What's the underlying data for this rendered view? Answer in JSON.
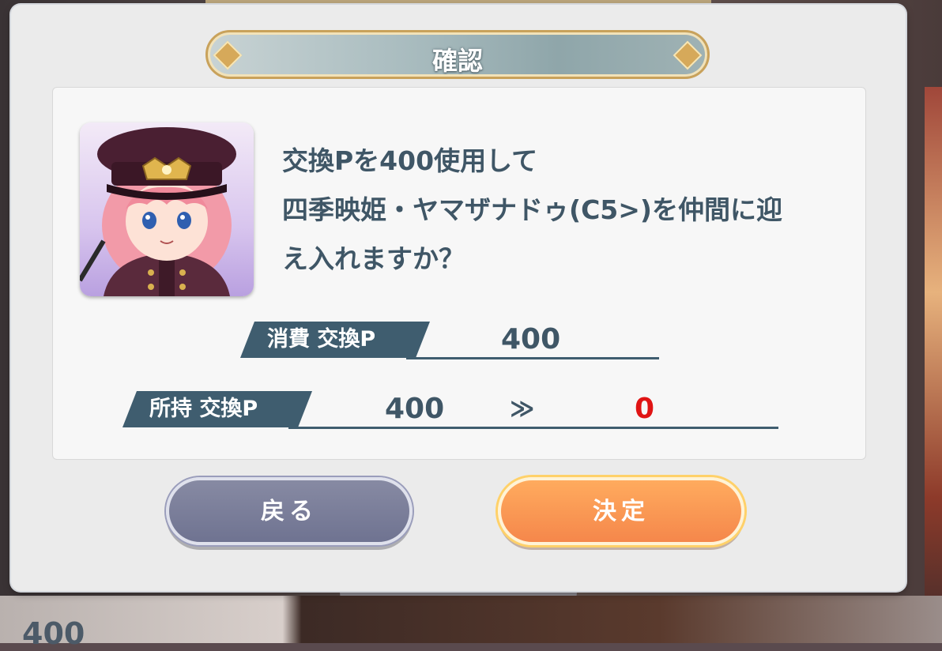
{
  "dialog": {
    "title": "確認",
    "message_lines": [
      "交換Pを400使用して",
      "四季映姫・ヤマザナドゥ(C5>)を仲間に迎",
      "え入れますか？"
    ],
    "cost": {
      "label": "消費 交換P",
      "value": "400"
    },
    "owned": {
      "label": "所持 交換P",
      "before": "400",
      "arrow": "≫",
      "after": "0"
    },
    "buttons": {
      "back": "戻る",
      "confirm": "決定"
    }
  },
  "background": {
    "partial_number": "400"
  },
  "colors": {
    "accent_text": "#3f5666",
    "label_bg": "#3f5d6f",
    "after_value": "#e01414",
    "confirm_button": "#f5874b",
    "back_button": "#6f7391",
    "title_border": "#c9a25b"
  }
}
